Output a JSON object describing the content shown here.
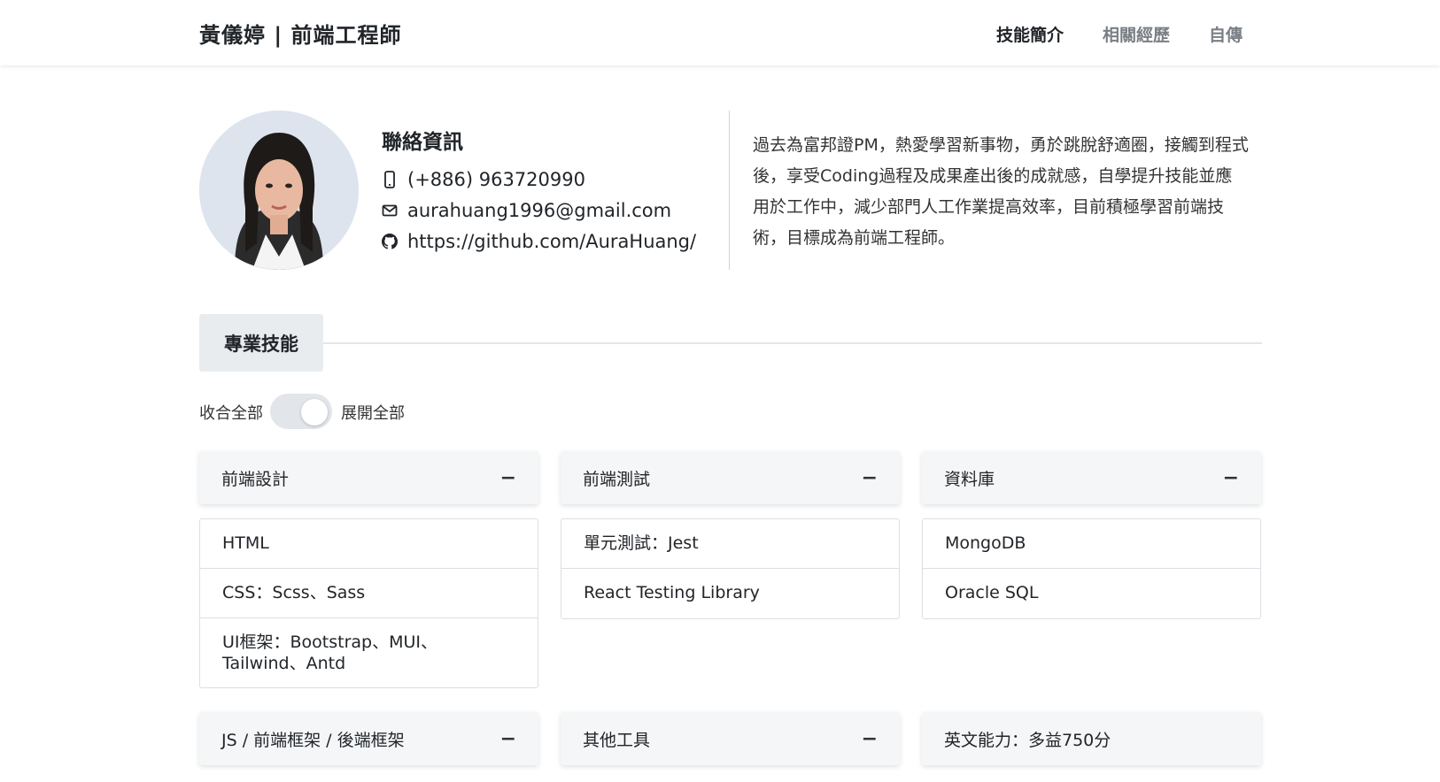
{
  "header": {
    "brand": "黃儀婷 | 前端工程師",
    "nav": [
      {
        "label": "技能簡介",
        "active": true
      },
      {
        "label": "相關經歷",
        "active": false
      },
      {
        "label": "自傳",
        "active": false
      }
    ]
  },
  "profile": {
    "contact_title": "聯絡資訊",
    "phone": "(+886) 963720990",
    "email": "aurahuang1996@gmail.com",
    "github": "https://github.com/AuraHuang/",
    "intro": "過去為富邦證PM，熱愛學習新事物，勇於跳脫舒適圈，接觸到程式後，享受Coding過程及成果產出後的成就感，自學提升技能並應用於工作中，減少部門人工作業提高效率，目前積極學習前端技術，目標成為前端工程師。"
  },
  "skills": {
    "section_title": "專業技能",
    "toggle_left": "收合全部",
    "toggle_right": "展開全部",
    "cards": [
      {
        "title": "前端設計",
        "items": [
          "HTML",
          "CSS：Scss、Sass",
          "UI框架：Bootstrap、MUI、Tailwind、Antd"
        ]
      },
      {
        "title": "前端測試",
        "items": [
          "單元測試：Jest",
          "React Testing Library"
        ]
      },
      {
        "title": "資料庫",
        "items": [
          "MongoDB",
          "Oracle SQL"
        ]
      },
      {
        "title": "JS / 前端框架 / 後端框架",
        "items": []
      },
      {
        "title": "其他工具",
        "items": []
      },
      {
        "title": "英文能力：多益750分",
        "items": []
      }
    ],
    "collapse_symbol": "−"
  }
}
